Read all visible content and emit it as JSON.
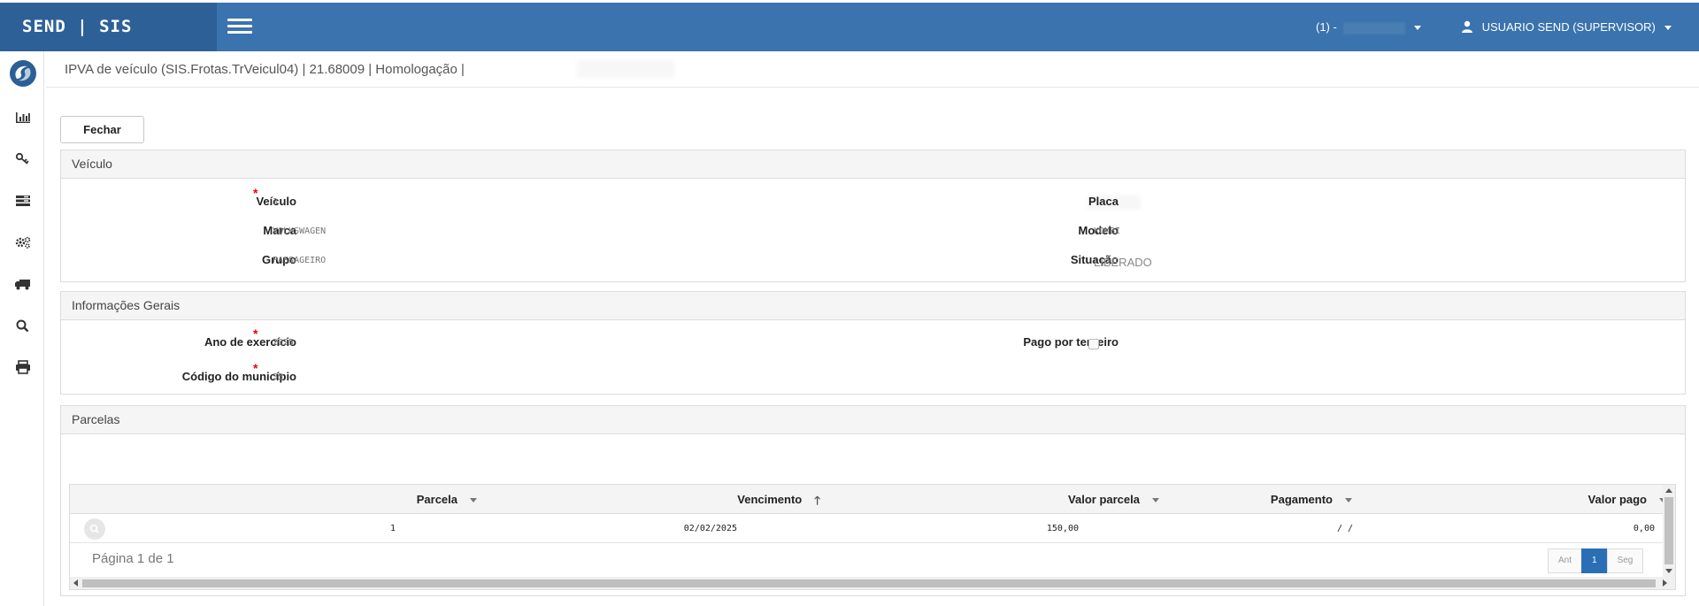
{
  "topbar": {
    "brand": "SEND | SIS",
    "company": "(1) -",
    "user": "USUARIO SEND (SUPERVISOR)"
  },
  "header": {
    "title": "IPVA de veículo (SIS.Frotas.TrVeicul04) | 21.68009 | Homologação |"
  },
  "actions": {
    "close_label": "Fechar"
  },
  "vehicle_panel": {
    "title": "Veículo",
    "veiculo_label": "Veículo",
    "veiculo_value": "3",
    "marca_label": "Marca",
    "marca_value": "VOLKSWAGEN",
    "grupo_label": "Grupo",
    "grupo_value": "PASSAGEIRO",
    "placa_label": "Placa",
    "modelo_label": "Modelo",
    "modelo_value": "KOMBI",
    "situacao_label": "Situação",
    "situacao_value": "LIBERADO"
  },
  "info_panel": {
    "title": "Informações Gerais",
    "ano_label": "Ano de exercício",
    "ano_value": "2025",
    "municipio_label": "Código do município",
    "municipio_value": "35",
    "pago_label": "Pago por terceiro",
    "pago_checked": false
  },
  "parcelas_panel": {
    "title": "Parcelas",
    "columns": [
      "Parcela",
      "Vencimento",
      "Valor parcela",
      "Pagamento",
      "Valor pago"
    ],
    "rows": [
      {
        "parcela": "1",
        "vencimento": "02/02/2025",
        "valor_parcela": "150,00",
        "pagamento": "/ /",
        "valor_pago": "0,00"
      }
    ],
    "page_info": "Página 1 de 1",
    "pager": {
      "prev": "Ant",
      "current": "1",
      "next": "Seg"
    }
  },
  "icons": [
    "logo-icon",
    "chart-icon",
    "key-icon",
    "list-icon",
    "gears-icon",
    "truck-icon",
    "search-icon",
    "print-icon",
    "user-icon"
  ],
  "colors": {
    "topbar": "#3a73ad",
    "brand": "#2e6098",
    "required": "#ee0000",
    "pager_active": "#2a6fb6"
  }
}
